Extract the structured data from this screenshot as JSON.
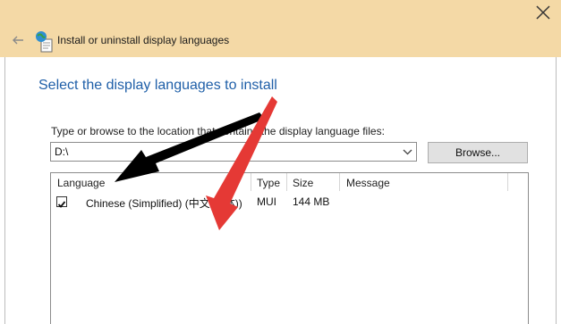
{
  "window": {
    "title": "Install or uninstall display languages",
    "colors": {
      "titlebar": "#f4d9a6",
      "heading": "#1f5fa8"
    }
  },
  "page": {
    "heading": "Select the display languages to install",
    "location_label": "Type or browse to the location that contains the display language files:",
    "path_value": "D:\\",
    "browse_label": "Browse..."
  },
  "table": {
    "columns": [
      "Language",
      "Type",
      "Size",
      "Message"
    ],
    "rows": [
      {
        "checked": true,
        "language": "Chinese (Simplified) (中文(简体))",
        "type": "MUI",
        "size": "144 MB",
        "message": ""
      }
    ]
  },
  "annotations": {
    "arrows": [
      {
        "color": "#000000",
        "target": "Language column header"
      },
      {
        "color": "#e53935",
        "target": "Chinese (Simplified) row"
      }
    ]
  }
}
